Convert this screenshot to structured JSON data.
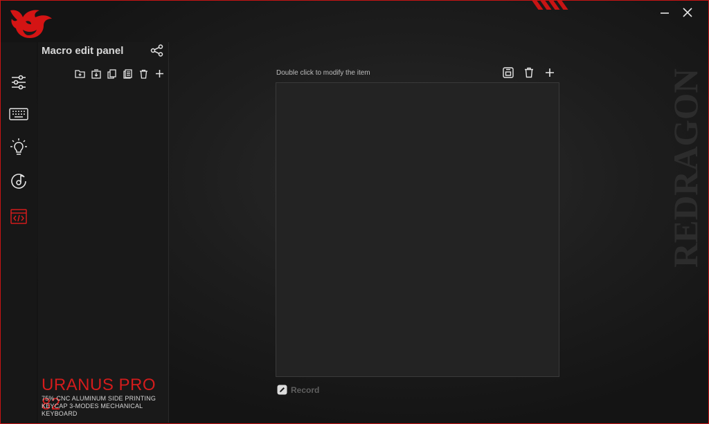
{
  "brand": {
    "logo_icon": "redragon-dragon-logo-icon",
    "watermark": "REDRAGON",
    "accent": "#c81414"
  },
  "window": {
    "minimize_icon": "minimize-icon",
    "close_icon": "close-icon"
  },
  "rail": {
    "items": [
      {
        "name": "settings-sliders",
        "icon": "sliders-icon",
        "active": false
      },
      {
        "name": "keyboard",
        "icon": "keyboard-icon",
        "active": false
      },
      {
        "name": "lighting",
        "icon": "lightbulb-icon",
        "active": false
      },
      {
        "name": "audio",
        "icon": "music-disc-icon",
        "active": false
      },
      {
        "name": "macro",
        "icon": "code-window-icon",
        "active": true
      }
    ]
  },
  "panel": {
    "title": "Macro edit panel",
    "share_icon": "share-icon",
    "toolbar": [
      "new-folder-icon",
      "import-icon",
      "copy-icon",
      "document-icon",
      "trash-icon",
      "plus-icon"
    ]
  },
  "product": {
    "name": "URANUS PRO 82",
    "desc_line1": "75% CNC ALUMINUM SIDE PRINTING",
    "desc_line2": "KEYCAP 3-MODES MECHANICAL KEYBOARD"
  },
  "editor": {
    "hint": "Double click to modify the item",
    "tools": [
      "save-icon",
      "trash-icon",
      "plus-icon"
    ],
    "record_label": "Record",
    "record_icon": "pencil-icon"
  }
}
